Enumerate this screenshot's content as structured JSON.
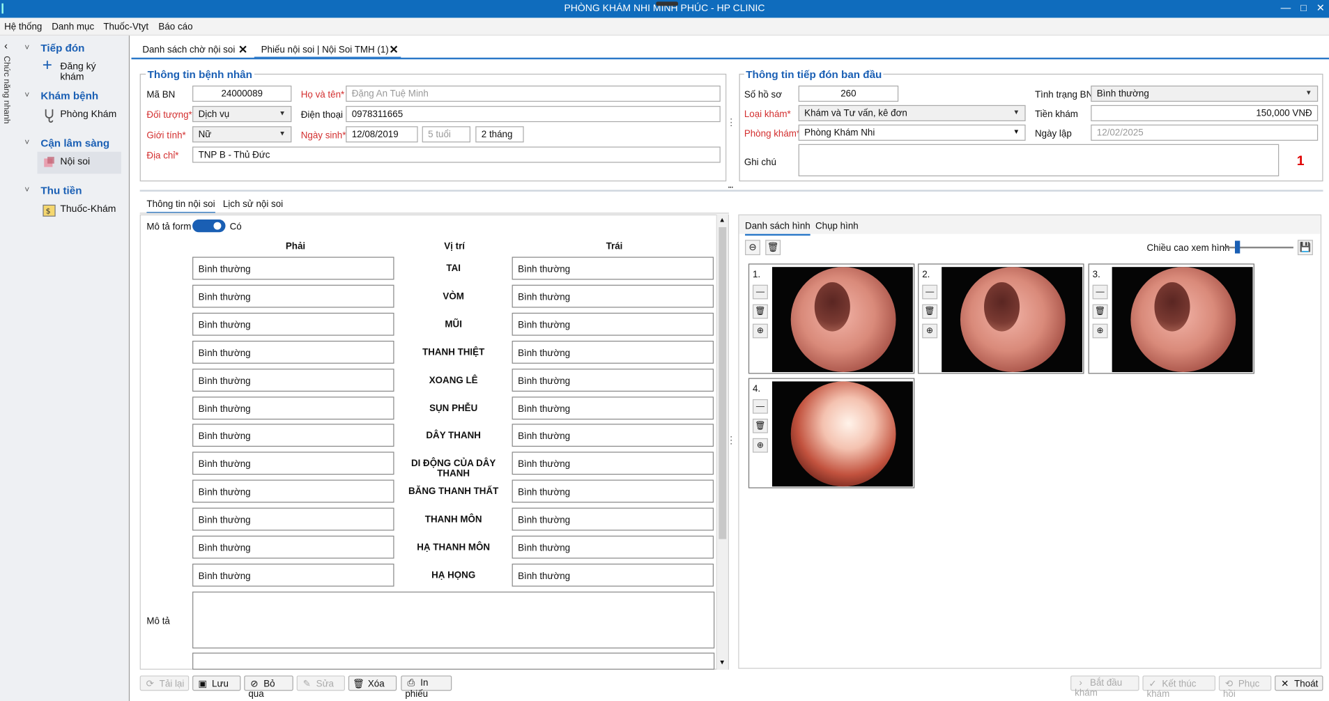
{
  "window": {
    "title": "PHÒNG KHÁM NHI MINH PHÚC - HP CLINIC"
  },
  "menu": [
    "Hệ thống",
    "Danh mục",
    "Thuốc-Vtyt",
    "Báo cáo"
  ],
  "sidebar": {
    "vertical_label": "Chức năng nhanh",
    "groups": [
      {
        "title": "Tiếp đón",
        "item": "Đăng ký khám",
        "icon": "plus-icon"
      },
      {
        "title": "Khám bệnh",
        "item": "Phòng Khám",
        "icon": "stethoscope-icon"
      },
      {
        "title": "Cận lâm sàng",
        "item": "Nội soi",
        "icon": "endoscope-icon"
      },
      {
        "title": "Thu tiền",
        "item": "Thuốc-Khám",
        "icon": "money-icon"
      }
    ]
  },
  "tabs": [
    "Danh sách chờ nội soi",
    "Phiếu nội soi | Nội Soi TMH (1)"
  ],
  "patient": {
    "legend": "Thông tin bệnh nhân",
    "ma_bn_label": "Mã BN",
    "ma_bn": "24000089",
    "ho_ten_label": "Họ và tên*",
    "ho_ten": "Đặng An Tuệ Minh",
    "doi_tuong_label": "Đối tượng*",
    "doi_tuong": "Dịch vụ",
    "dien_thoai_label": "Điện thoại",
    "dien_thoai": "0978311665",
    "gioi_tinh_label": "Giới tính*",
    "gioi_tinh": "Nữ",
    "ngay_sinh_label": "Ngày sinh*",
    "ngay_sinh": "12/08/2019",
    "tuoi": "5 tuổi",
    "thang": "2 tháng",
    "dia_chi_label": "Địa chỉ*",
    "dia_chi": "TNP B - Thủ Đức"
  },
  "reception": {
    "legend": "Thông tin tiếp đón ban đầu",
    "so_ho_so_label": "Số hồ sơ",
    "so_ho_so": "260",
    "tinh_trang_label": "Tình trạng BN",
    "tinh_trang": "Bình thường",
    "loai_kham_label": "Loại khám*",
    "loai_kham": "Khám và Tư vấn, kê đơn",
    "tien_kham_label": "Tiền khám",
    "tien_kham": "150,000 VNĐ",
    "phong_kham_label": "Phòng khám*",
    "phong_kham": "Phòng Khám Nhi",
    "ngay_lap_label": "Ngày lập",
    "ngay_lap": "12/02/2025",
    "ghi_chu_label": "Ghi chú",
    "count": "1"
  },
  "endo": {
    "tabs": [
      "Thông tin nội soi",
      "Lịch sử nội soi"
    ],
    "mo_ta_form_label": "Mô tả form",
    "toggle_value": "Có",
    "col_phai": "Phải",
    "col_vitri": "Vị trí",
    "col_trai": "Trái",
    "rows": [
      {
        "phai": "Bình thường",
        "vitri": "TAI",
        "trai": "Bình thường"
      },
      {
        "phai": "Bình thường",
        "vitri": "VÒM",
        "trai": "Bình thường"
      },
      {
        "phai": "Bình thường",
        "vitri": "MŨI",
        "trai": "Bình thường"
      },
      {
        "phai": "Bình thường",
        "vitri": "THANH THIỆT",
        "trai": "Bình thường"
      },
      {
        "phai": "Bình thường",
        "vitri": "XOANG LÊ",
        "trai": "Bình thường"
      },
      {
        "phai": "Bình thường",
        "vitri": "SỤN PHỄU",
        "trai": "Bình thường"
      },
      {
        "phai": "Bình thường",
        "vitri": "DÂY THANH",
        "trai": "Bình thường"
      },
      {
        "phai": "Bình thường",
        "vitri": "DI ĐỘNG CỦA DÂY THANH",
        "trai": "Bình thường"
      },
      {
        "phai": "Bình thường",
        "vitri": "BĂNG THANH THẤT",
        "trai": "Bình thường"
      },
      {
        "phai": "Bình thường",
        "vitri": "THANH MÔN",
        "trai": "Bình thường"
      },
      {
        "phai": "Bình thường",
        "vitri": "HẠ THANH MÔN",
        "trai": "Bình thường"
      },
      {
        "phai": "Bình thường",
        "vitri": "HẠ HỌNG",
        "trai": "Bình thường"
      }
    ],
    "mo_ta_label": "Mô tả"
  },
  "images": {
    "tabs": [
      "Danh sách hình",
      "Chụp hình"
    ],
    "zoom_label": "Chiều cao xem hình",
    "zoom_level": 0.2,
    "thumbs": [
      {
        "num": "1."
      },
      {
        "num": "2."
      },
      {
        "num": "3."
      },
      {
        "num": "4."
      }
    ]
  },
  "buttons": {
    "tai_lai": "Tải lại",
    "luu": "Lưu",
    "bo_qua": "Bỏ qua",
    "sua": "Sửa",
    "xoa": "Xóa",
    "in_phieu": "In phiếu",
    "bat_dau": "Bắt đầu khám",
    "ket_thuc": "Kết thúc khám",
    "phuc_hoi": "Phục hồi",
    "thoat": "Thoát"
  },
  "colors": {
    "accent": "#0f6cbd",
    "required": "#d32f2f",
    "count": "#e00000"
  }
}
